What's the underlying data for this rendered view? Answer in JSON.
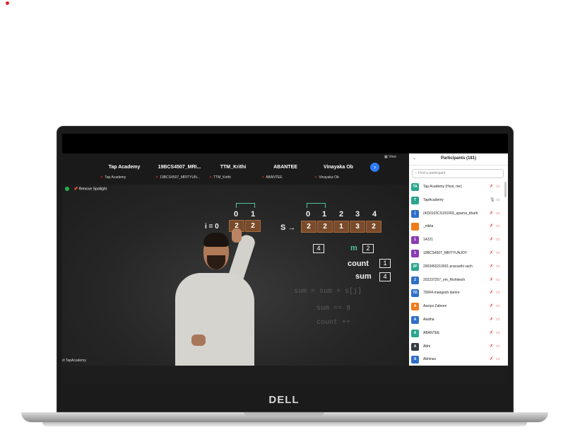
{
  "brand": {
    "laptop_logo": "DELL"
  },
  "strip": {
    "tiles": [
      {
        "name": "Tap Academy",
        "sub": "Tap Academy"
      },
      {
        "name": "19BCS4507_MRI...",
        "sub": "19BCS4507_MRITYUN..."
      },
      {
        "name": "TTM_Krithi",
        "sub": "TTM_Krithi"
      },
      {
        "name": "ABANTEE",
        "sub": "ABANTEE"
      },
      {
        "name": "Vinayaka Ob",
        "sub": "Vinayaka Ob"
      }
    ],
    "next_icon": "›",
    "view_label": "View"
  },
  "video": {
    "remove_spotlight": "Remove Spotlight",
    "owner_label": "TapAcademy",
    "board": {
      "i_eq": "i = 0",
      "s_arrow": "S →",
      "left_indices": [
        "0",
        "1"
      ],
      "left_cells": [
        "2",
        "2"
      ],
      "right_indices": [
        "0",
        "1",
        "2",
        "3",
        "4"
      ],
      "right_cells": [
        "2",
        "2",
        "1",
        "3",
        "2"
      ],
      "k_value": "4",
      "m_label": "m",
      "m_value": "2",
      "count_label": "count",
      "count_value": "1",
      "sum_label": "sum",
      "sum_value": "4",
      "faded_1": "sum = sum + s[j]",
      "faded_2": "sum == 8",
      "faded_3": "count ++"
    }
  },
  "panel": {
    "title": "Participants (181)",
    "collapse_icon": "⌄",
    "search_placeholder": "Find a participant",
    "participants": [
      {
        "initials": "TA",
        "name": "Tap Academy (Host, me)",
        "color": "#2aa58e",
        "mic": "off"
      },
      {
        "initials": "T",
        "name": "TapAcademy",
        "color": "#2aa58e",
        "mic": "on"
      },
      {
        "initials": "(",
        "name": "(40)0103CS191069_aparna_bharti",
        "color": "#2f6fc9",
        "mic": "off"
      },
      {
        "initials": "",
        "name": "_nikita",
        "color": "#f07a1a",
        "mic": "off"
      },
      {
        "initials": "1",
        "name": "14221",
        "color": "#8a3bb5",
        "mic": "off"
      },
      {
        "initials": "1",
        "name": "19BCS4507_MRITYUNJOY",
        "color": "#8a3bb5",
        "mic": "off"
      },
      {
        "initials": "2P",
        "name": "2003450210001 pracasthi vach",
        "color": "#2aa58e",
        "mic": "off"
      },
      {
        "initials": "2",
        "name": "202237257_om_Rishikesh",
        "color": "#2f6fc9",
        "mic": "off"
      },
      {
        "initials": "7D",
        "name": "70064-mangesh damre",
        "color": "#2f6fc9",
        "mic": "off"
      },
      {
        "initials": "A",
        "name": "Aasiya Zabeen",
        "color": "#f07a1a",
        "mic": "off"
      },
      {
        "initials": "A",
        "name": "Aastha",
        "color": "#2f6fc9",
        "mic": "off"
      },
      {
        "initials": "A",
        "name": "ABANTEE",
        "color": "#2aa58e",
        "mic": "off"
      },
      {
        "initials": "A",
        "name": "Abhi",
        "color": "#333a44",
        "mic": "off"
      },
      {
        "initials": "A",
        "name": "Abhinav",
        "color": "#2f6fc9",
        "mic": "off"
      }
    ]
  }
}
